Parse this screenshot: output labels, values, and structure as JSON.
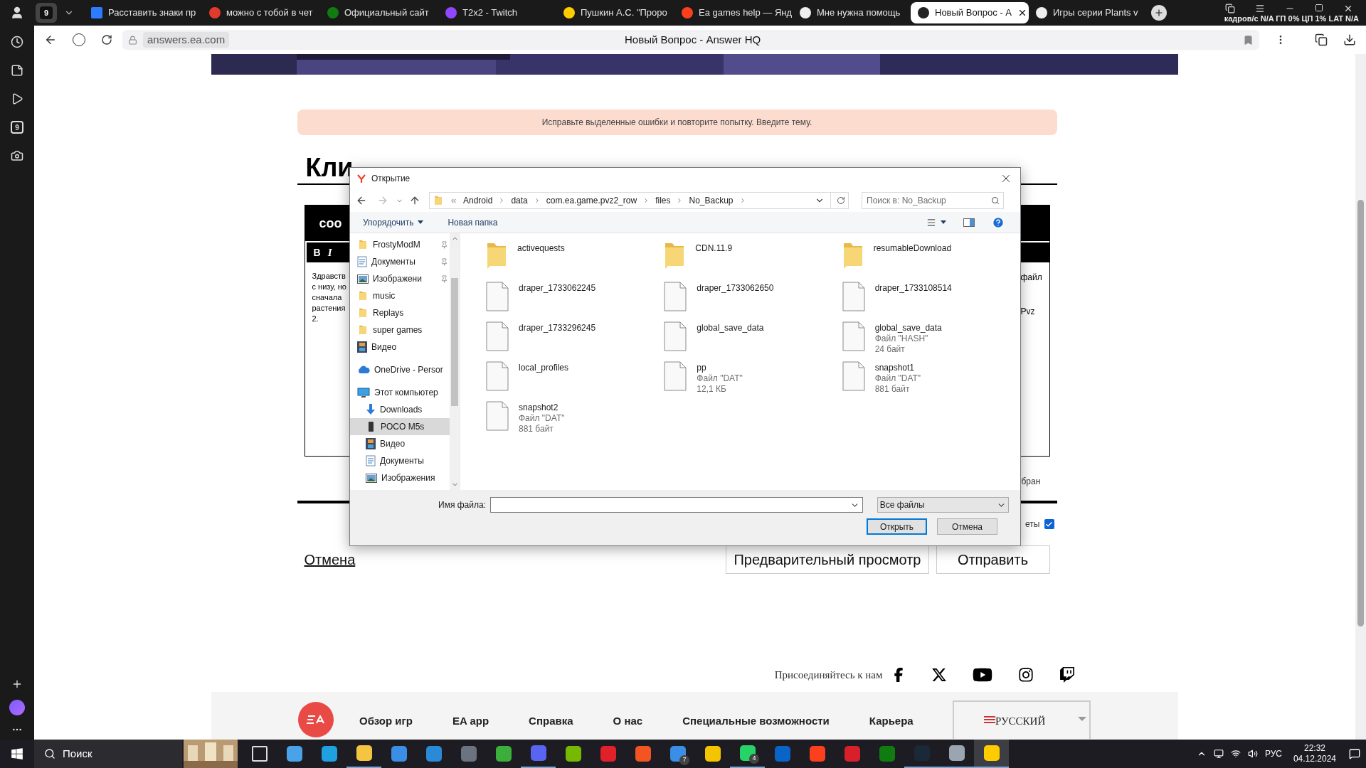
{
  "browser": {
    "group_count": "9",
    "tabs": [
      {
        "title": "Расставить знаки пр",
        "selected": false
      },
      {
        "title": "можно с тобой в чет",
        "selected": false
      },
      {
        "title": "Официальный сайт",
        "selected": false
      },
      {
        "title": "T2x2 - Twitch",
        "selected": false
      },
      {
        "title": "Пушкин А.С. \"Проро",
        "selected": false
      },
      {
        "title": "Ea games help — Янд",
        "selected": false
      },
      {
        "title": "Мне нужна помощь",
        "selected": false
      },
      {
        "title": "Новый Вопрос - A",
        "selected": true
      },
      {
        "title": "Игры серии Plants v",
        "selected": false
      }
    ],
    "overlay_stats": "кадров/с  N/A ГП  0% ЦП  1% LAT  N/A",
    "url": "answers.ea.com",
    "page_title": "Новый Вопрос - Answer HQ",
    "sidebar_badge": "9"
  },
  "page": {
    "alert": "Исправьте выделенные ошибки и повторите попытку. Введите тему.",
    "heading": "Кли",
    "editor": {
      "header": "соо",
      "bold": "B",
      "italic": "I",
      "left_lines": [
        "Здравств",
        "с низу, но",
        "сначала",
        "растения",
        "2."
      ],
      "right_lines": [
        "файл",
        "Pvz"
      ]
    },
    "note_fragment": "бран",
    "checkbox": {
      "label": "еты",
      "checked": true
    },
    "cancel_link": "Отмена",
    "preview_button": "Предварительный просмотр",
    "submit_button": "Отправить",
    "join_text": "Присоединяйтесь к нам",
    "footer_links": [
      "Обзор игр",
      "EA app",
      "Справка",
      "О нас",
      "Специальные возможности",
      "Карьера"
    ],
    "language": "РУССКИЙ"
  },
  "dialog": {
    "title": "Открытие",
    "breadcrumb": [
      "Android",
      "data",
      "com.ea.game.pvz2_row",
      "files",
      "No_Backup"
    ],
    "search_placeholder": "Поиск в: No_Backup",
    "organize": "Упорядочить",
    "new_folder": "Новая папка",
    "nav_tree": [
      {
        "kind": "group",
        "children": [
          {
            "label": "FrostyModM",
            "kind": "folder",
            "pinned": true,
            "selected": false
          },
          {
            "label": "Документы",
            "kind": "docs",
            "pinned": true,
            "selected": false
          },
          {
            "label": "Изображени",
            "kind": "pictures",
            "pinned": true,
            "selected": false
          },
          {
            "label": "music",
            "kind": "folder",
            "pinned": false,
            "selected": false
          },
          {
            "label": "Replays",
            "kind": "folder",
            "pinned": false,
            "selected": false
          },
          {
            "label": "super games",
            "kind": "folder",
            "pinned": false,
            "selected": false
          },
          {
            "label": "Видео",
            "kind": "video",
            "pinned": false,
            "selected": false
          }
        ]
      },
      {
        "label": "OneDrive - Persor",
        "kind": "cloud",
        "pinned": false,
        "selected": false
      },
      {
        "label": "Этот компьютер",
        "kind": "pc",
        "pinned": false,
        "selected": false,
        "children": [
          {
            "label": "Downloads",
            "kind": "download",
            "pinned": false,
            "selected": false
          },
          {
            "label": "POCO M5s",
            "kind": "phone",
            "pinned": false,
            "selected": true
          },
          {
            "label": "Видео",
            "kind": "video",
            "pinned": false,
            "selected": false
          },
          {
            "label": "Документы",
            "kind": "docs",
            "pinned": false,
            "selected": false
          },
          {
            "label": "Изображения",
            "kind": "pictures",
            "pinned": false,
            "selected": false
          }
        ]
      }
    ],
    "files": [
      {
        "name": "activequests",
        "kind": "folder"
      },
      {
        "name": "CDN.11.9",
        "kind": "folder"
      },
      {
        "name": "resumableDownload",
        "kind": "folder"
      },
      {
        "name": "draper_1733062245",
        "kind": "file"
      },
      {
        "name": "draper_1733062650",
        "kind": "file"
      },
      {
        "name": "draper_1733108514",
        "kind": "file"
      },
      {
        "name": "draper_1733296245",
        "kind": "file"
      },
      {
        "name": "global_save_data",
        "kind": "file"
      },
      {
        "name": "global_save_data",
        "kind": "file",
        "type": "Файл \"HASH\"",
        "size": "24 байт"
      },
      {
        "name": "local_profiles",
        "kind": "file"
      },
      {
        "name": "pp",
        "kind": "file",
        "type": "Файл \"DAT\"",
        "size": "12,1 КБ"
      },
      {
        "name": "snapshot1",
        "kind": "file",
        "type": "Файл \"DAT\"",
        "size": "881 байт"
      },
      {
        "name": "snapshot2",
        "kind": "file",
        "type": "Файл \"DAT\"",
        "size": "881 байт"
      }
    ],
    "filename_label": "Имя файла:",
    "filter": "Все файлы",
    "buttons": [
      {
        "label": "Открыть",
        "default": true
      },
      {
        "label": "Отмена",
        "default": false
      }
    ]
  },
  "taskbar": {
    "search": "Поиск",
    "apps": [
      {
        "kind": "taskview",
        "running": false,
        "selected": false
      },
      {
        "kind": "pc",
        "running": false,
        "selected": false
      },
      {
        "kind": "edge",
        "running": false,
        "selected": false
      },
      {
        "kind": "explorer",
        "running": true,
        "selected": false
      },
      {
        "kind": "store",
        "running": false,
        "selected": false
      },
      {
        "kind": "mail",
        "running": false,
        "selected": false
      },
      {
        "kind": "hex",
        "running": false,
        "selected": false
      },
      {
        "kind": "creeper",
        "running": false,
        "selected": false
      },
      {
        "kind": "discord",
        "running": true,
        "selected": false
      },
      {
        "kind": "nvidia",
        "running": false,
        "selected": false
      },
      {
        "kind": "opera",
        "running": false,
        "selected": false
      },
      {
        "kind": "ea",
        "running": false,
        "selected": false
      },
      {
        "kind": "screen",
        "badge": "7",
        "running": false,
        "selected": false
      },
      {
        "kind": "yellow",
        "running": false,
        "selected": false
      },
      {
        "kind": "whatsapp",
        "badge": "4",
        "running": true,
        "selected": false
      },
      {
        "kind": "outlook",
        "running": false,
        "selected": false
      },
      {
        "kind": "ya",
        "running": false,
        "selected": false
      },
      {
        "kind": "red",
        "running": false,
        "selected": false
      },
      {
        "kind": "xbox",
        "running": false,
        "selected": false
      },
      {
        "kind": "steam",
        "running": true,
        "selected": false
      },
      {
        "kind": "ring",
        "running": true,
        "selected": false
      },
      {
        "kind": "yabrowser",
        "running": true,
        "selected": true
      }
    ],
    "language": "РУС",
    "time": "22:32",
    "date": "04.12.2024"
  }
}
